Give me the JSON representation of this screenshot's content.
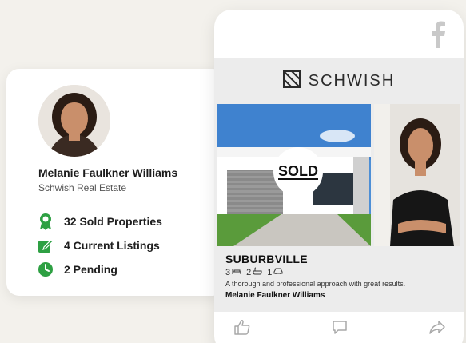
{
  "agent": {
    "name": "Melanie Faulkner Williams",
    "company": "Schwish Real Estate",
    "stats": [
      {
        "icon": "award-icon",
        "label": "32 Sold Properties"
      },
      {
        "icon": "listing-icon",
        "label": "4 Current Listings"
      },
      {
        "icon": "clock-icon",
        "label": "2 Pending"
      }
    ],
    "accent_color": "#2ea043"
  },
  "post": {
    "brand": "SCHWISH",
    "badge": "SOLD",
    "suburb": "SUBURBVILLE",
    "features": {
      "beds": "3",
      "baths": "2",
      "cars": "1"
    },
    "description": "A thorough and professional approach with great results.",
    "agent_name": "Melanie Faulkner Williams",
    "actions": [
      "like-icon",
      "comment-icon",
      "share-icon"
    ]
  }
}
